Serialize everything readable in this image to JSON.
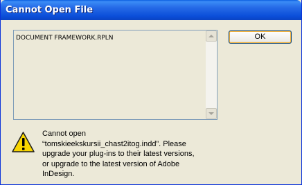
{
  "window": {
    "title": "Cannot Open File"
  },
  "list": {
    "items": [
      "DOCUMENT FRAMEWORK.RPLN"
    ]
  },
  "buttons": {
    "ok_label": "OK"
  },
  "message": {
    "lines": [
      "Cannot open",
      "“tomskieekskursii_chast2itog.indd”. Please",
      "upgrade your plug-ins to their latest versions,",
      "or upgrade to the latest version of Adobe",
      "InDesign."
    ]
  },
  "icons": {
    "warning": "warning-icon"
  }
}
